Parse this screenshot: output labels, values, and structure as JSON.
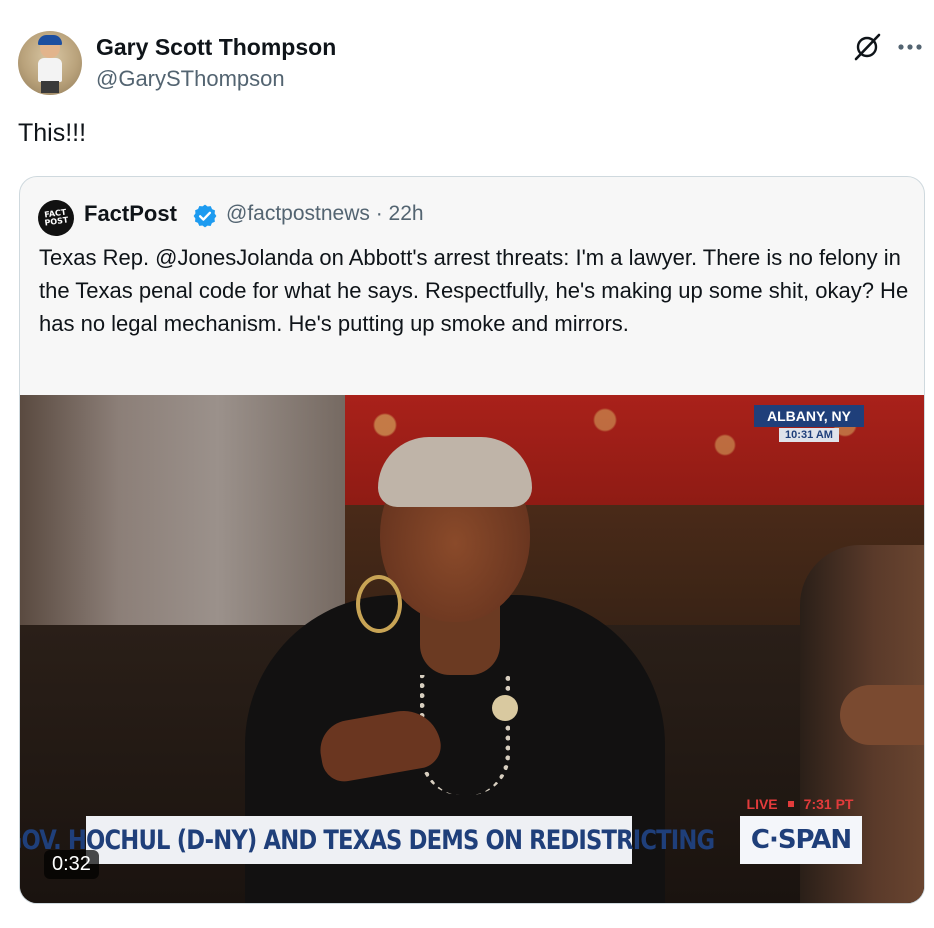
{
  "tweet": {
    "author": {
      "display_name": "Gary Scott Thompson",
      "handle": "@GarySThompson"
    },
    "text": "This!!!",
    "icons": {
      "grok": "grok-icon",
      "more": "more-icon"
    }
  },
  "quote": {
    "avatar_text": [
      "FACT",
      "POST"
    ],
    "author": {
      "display_name": "FactPost",
      "verified": true,
      "handle_and_time": "@factpostnews · 22h"
    },
    "text": "Texas Rep. @JonesJolanda on Abbott's arrest threats: I'm a lawyer. There is no felony in the Texas penal code for what he says. Respectfully, he's making up some shit, okay? He has no legal mechanism. He's putting up smoke and mirrors.",
    "video": {
      "location": "ALBANY, NY",
      "location_time": "10:31 AM",
      "live_label": "LIVE",
      "live_time": "7:31 PT",
      "chyron": "GOV. HOCHUL (D-NY) AND TEXAS DEMS ON REDISTRICTING",
      "network": "C·SPAN",
      "duration": "0:32"
    }
  },
  "colors": {
    "text_primary": "#0f1419",
    "text_secondary": "#536471",
    "verified_blue": "#1d9bf0",
    "card_border": "#cfd9de",
    "card_bg": "#f7f7f7",
    "cspan_blue": "#1f3f7a",
    "live_red": "#e23b3b"
  }
}
